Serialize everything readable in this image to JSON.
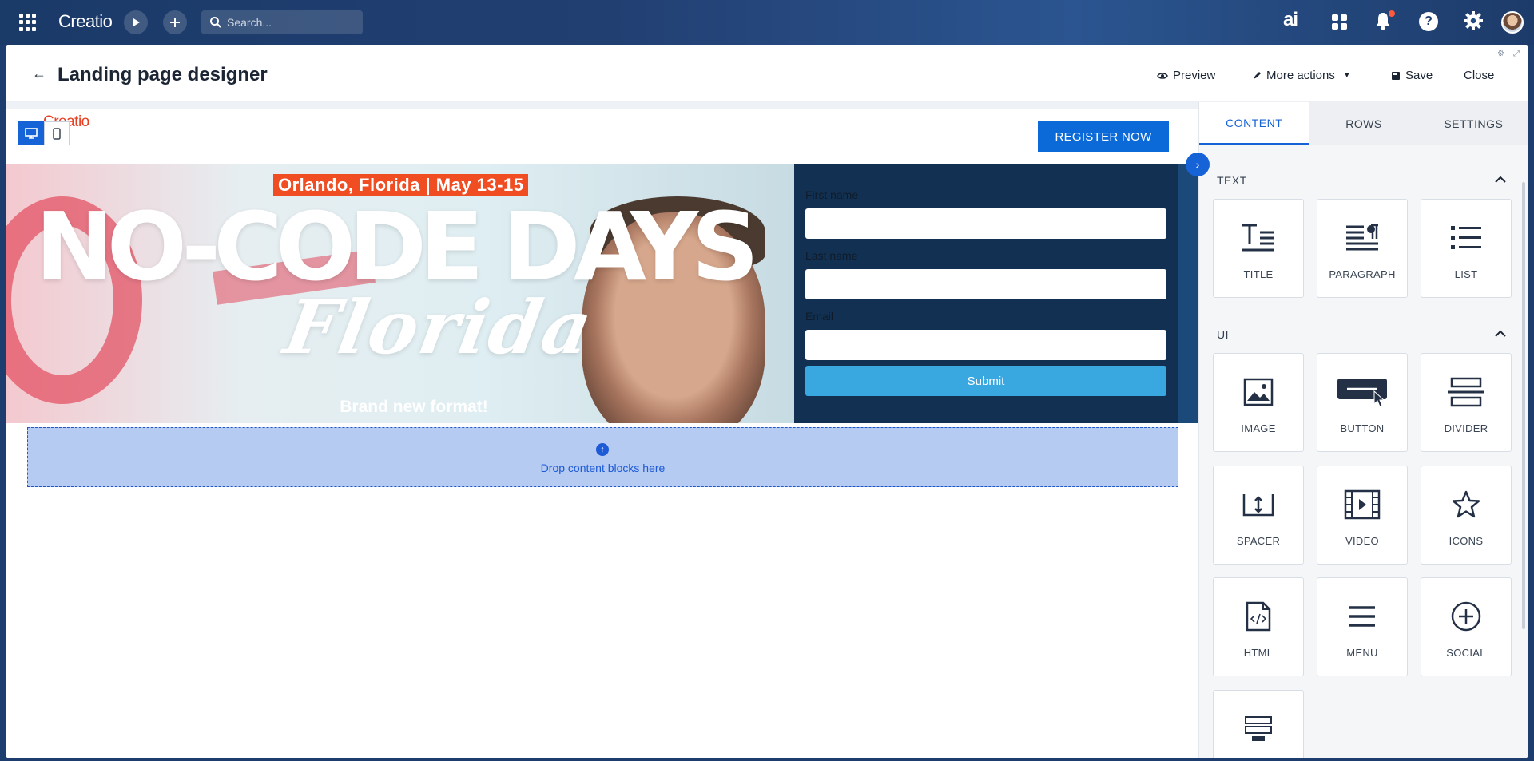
{
  "topbar": {
    "brand": "Creatio",
    "search_placeholder": "Search...",
    "ai_label": "ai"
  },
  "header": {
    "title": "Landing page designer",
    "preview": "Preview",
    "more_actions": "More actions",
    "save": "Save",
    "close": "Close"
  },
  "canvas": {
    "logo": "Creatio",
    "register_button": "REGISTER NOW",
    "hero": {
      "badge": "Orlando, Florida | May 13-15",
      "headline": "NO-CODE DAYS",
      "script": "Florida",
      "tagline": "Brand new format!"
    },
    "form": {
      "first_name": "First name",
      "last_name": "Last name",
      "email": "Email",
      "submit": "Submit"
    },
    "drop_text": "Drop content blocks here"
  },
  "panel": {
    "tabs": [
      "CONTENT",
      "ROWS",
      "SETTINGS"
    ],
    "text_section": "TEXT",
    "ui_section": "UI",
    "text_tiles": [
      "TITLE",
      "PARAGRAPH",
      "LIST"
    ],
    "ui_tiles": [
      "IMAGE",
      "BUTTON",
      "DIVIDER",
      "SPACER",
      "VIDEO",
      "ICONS",
      "HTML",
      "MENU",
      "SOCIAL"
    ]
  },
  "colors": {
    "accent": "#1563d6",
    "register": "#0b6ad8",
    "badge": "#f04d23",
    "form_bg": "#123152",
    "submit": "#3aa8e0"
  }
}
